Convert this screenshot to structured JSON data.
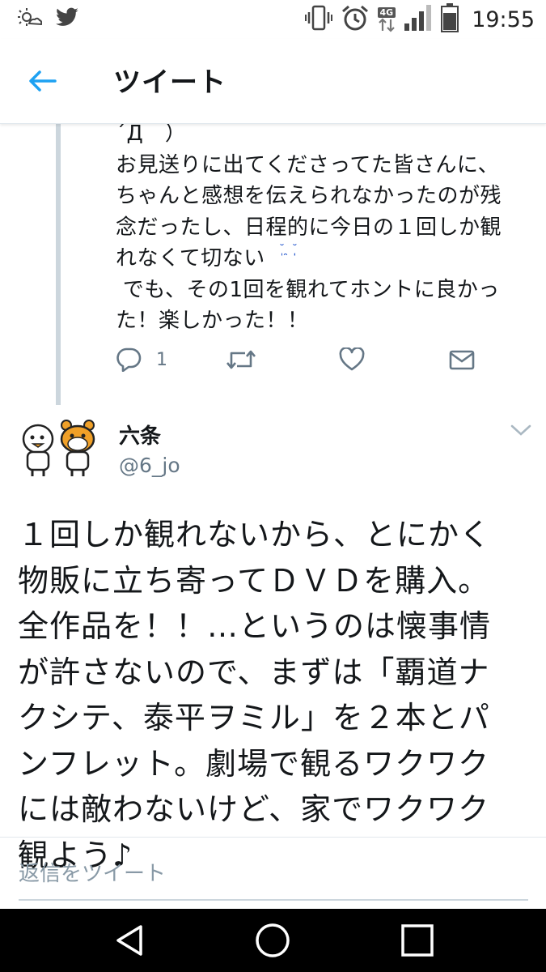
{
  "status_bar": {
    "time": "19:55",
    "network": "4G",
    "icons": [
      "weather-icon",
      "twitter-bird-icon",
      "vibrate-icon",
      "alarm-icon",
      "signal-icon",
      "battery-icon"
    ]
  },
  "header": {
    "back_icon": "arrow-left-icon",
    "title": "ツイート"
  },
  "previous_tweet": {
    "text": "´Д｀）\nお見送りに出てくださってた皆さんに、\nちゃんと感想を伝えられなかったのが残\n念だったし、日程的に今日の１回しか観\nれなくて切ない\n でも、その1回を観れてホントに良かっ\nた！楽しかった！！",
    "emoji": "˘̩̩̩ ̯ ˘̩̩̩",
    "reply_count": "1",
    "actions": [
      "reply-icon",
      "retweet-icon",
      "like-icon",
      "dm-icon"
    ]
  },
  "tweet": {
    "author_name": "六条",
    "author_handle": "@6_jo",
    "text": "１回しか観れないから、とにかく\n物販に立ち寄ってＤＶＤを購入。\n全作品を！！…というのは懐事情\nが許さないので、まずは「覇道ナ\nクシテ、泰平ヲミル」を２本とパ\nンフレット。劇場で観るワクワク\nには敵わないけど、家でワクワク\n観よう♪"
  },
  "reply_placeholder": "返信をツイート",
  "colors": {
    "accent": "#1da1f2",
    "secondary_text": "#657786",
    "thread_line": "#ccd6dd"
  }
}
